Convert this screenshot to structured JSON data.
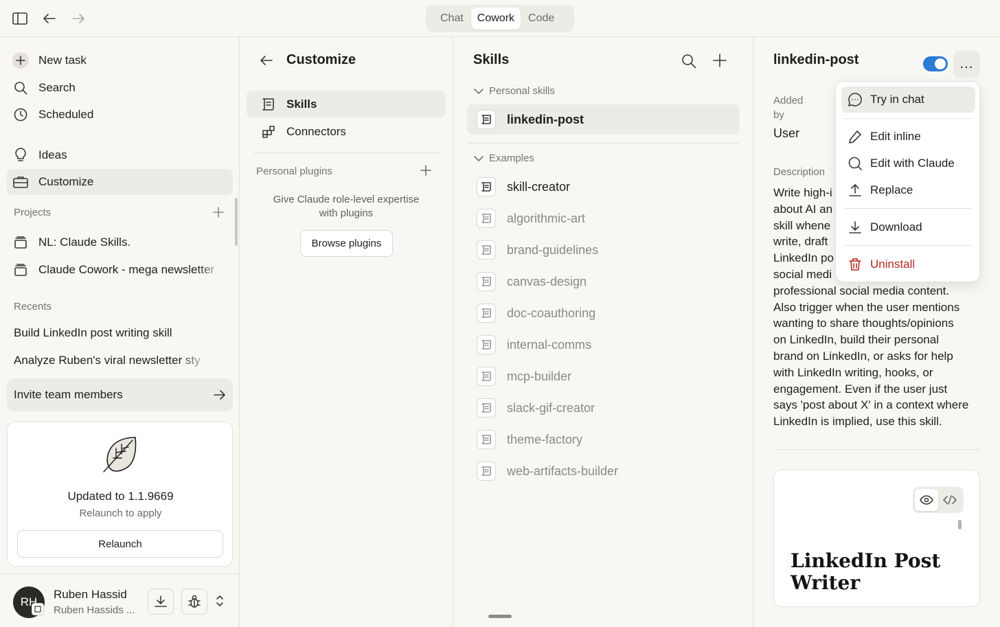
{
  "modes": [
    "Chat",
    "Cowork",
    "Code"
  ],
  "active_mode": "Cowork",
  "sidebar": {
    "new_task": "New task",
    "search": "Search",
    "scheduled": "Scheduled",
    "ideas": "Ideas",
    "customize": "Customize",
    "projects_label": "Projects",
    "projects": [
      "NL: Claude Skills.",
      "Claude Cowork - mega newsletter"
    ],
    "recents_label": "Recents",
    "recents": [
      "Build LinkedIn post writing skill",
      "Analyze Ruben's viral newsletter sty"
    ],
    "invite": "Invite team members",
    "update_title": "Updated to 1.1.9669",
    "update_sub": "Relaunch to apply",
    "relaunch": "Relaunch",
    "user_initials": "RH",
    "user_name": "Ruben Hassid",
    "user_sub": "Ruben Hassids ..."
  },
  "customize": {
    "title": "Customize",
    "skills": "Skills",
    "connectors": "Connectors",
    "personal_plugins": "Personal plugins",
    "plugins_hint": "Give Claude role-level expertise with plugins",
    "browse_plugins": "Browse plugins"
  },
  "skills": {
    "title": "Skills",
    "personal_label": "Personal skills",
    "personal": [
      "linkedin-post"
    ],
    "examples_label": "Examples",
    "examples": [
      "skill-creator",
      "algorithmic-art",
      "brand-guidelines",
      "canvas-design",
      "doc-coauthoring",
      "internal-comms",
      "mcp-builder",
      "slack-gif-creator",
      "theme-factory",
      "web-artifacts-builder"
    ]
  },
  "detail": {
    "title": "linkedin-post",
    "more": "...",
    "added_by_label": "Added by",
    "added_by": "User",
    "description_label": "Description",
    "description_lines": [
      "Write high-i",
      "about AI an",
      "skill whene",
      "write, draft",
      "LinkedIn po",
      "social medi",
      "professional social media content.",
      "Also trigger when the user mentions",
      "wanting to share thoughts/opinions",
      "on LinkedIn, build their personal",
      "brand on LinkedIn, or asks for help",
      "with LinkedIn writing, hooks, or",
      "engagement. Even if the user just",
      "says 'post about X' in a context where",
      "LinkedIn is implied, use this skill."
    ],
    "preview_title": "LinkedIn Post Writer"
  },
  "menu": {
    "try_in_chat": "Try in chat",
    "edit_inline": "Edit inline",
    "edit_with_claude": "Edit with Claude",
    "replace": "Replace",
    "download": "Download",
    "uninstall": "Uninstall"
  },
  "colors": {
    "accent": "#2d7bd6",
    "danger": "#b3261e",
    "selected": "#ecebe5"
  }
}
